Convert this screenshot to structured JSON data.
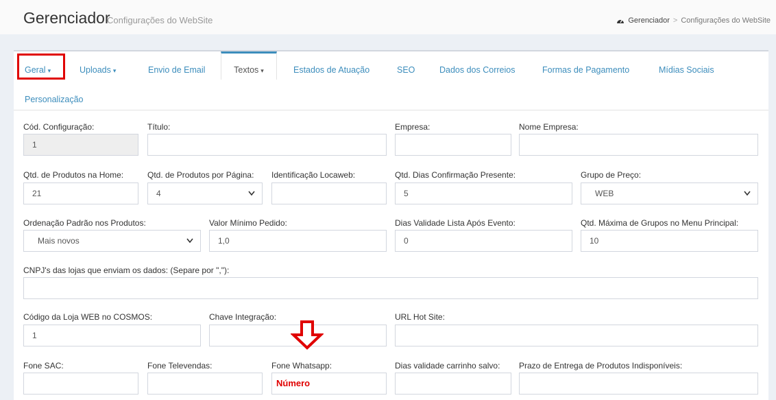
{
  "header": {
    "title": "Gerenciador",
    "subtitle": "Configurações do WebSite",
    "breadcrumb": {
      "home_icon": "dashboard-icon",
      "home": "Gerenciador",
      "separator": ">",
      "current": "Configurações do WebSite"
    }
  },
  "tabs": {
    "geral": "Geral",
    "uploads": "Uploads",
    "envio_email": "Envio de Email",
    "textos": "Textos",
    "estados": "Estados de Atuação",
    "seo": "SEO",
    "correios": "Dados dos Correios",
    "pagamento": "Formas de Pagamento",
    "midias": "Mídias Sociais",
    "personalizacao": "Personalização",
    "caret": "▾"
  },
  "form": {
    "cod_config": {
      "label": "Cód. Configuração:",
      "value": "1"
    },
    "titulo": {
      "label": "Título:",
      "value": ""
    },
    "empresa": {
      "label": "Empresa:",
      "value": ""
    },
    "nome_empresa": {
      "label": "Nome Empresa:",
      "value": ""
    },
    "qtd_home": {
      "label": "Qtd. de Produtos na Home:",
      "value": "21"
    },
    "qtd_pagina": {
      "label": "Qtd. de Produtos por Página:",
      "value": "4"
    },
    "locaweb": {
      "label": "Identificação Locaweb:",
      "value": ""
    },
    "dias_presente": {
      "label": "Qtd. Dias Confirmação Presente:",
      "value": "5"
    },
    "grupo_preco": {
      "label": "Grupo de Preço:",
      "value": "WEB"
    },
    "ordenacao": {
      "label": "Ordenação Padrão nos Produtos:",
      "value": "Mais novos"
    },
    "valor_minimo": {
      "label": "Valor Mínimo Pedido:",
      "value": "1,0"
    },
    "dias_lista": {
      "label": "Dias Validade Lista Após Evento:",
      "value": "0"
    },
    "qtd_grupos": {
      "label": "Qtd. Máxima de Grupos no Menu Principal:",
      "value": "10"
    },
    "cnpj": {
      "label": "CNPJ's das lojas que enviam os dados: (Separe por \",\"):",
      "value": ""
    },
    "cosmos": {
      "label": "Código da Loja WEB no COSMOS:",
      "value": "1"
    },
    "chave": {
      "label": "Chave Integração:",
      "value": ""
    },
    "url_hot": {
      "label": "URL Hot Site:",
      "value": ""
    },
    "fone_sac": {
      "label": "Fone SAC:",
      "value": ""
    },
    "fone_televendas": {
      "label": "Fone Televendas:",
      "value": ""
    },
    "fone_whatsapp": {
      "label": "Fone Whatsapp:",
      "value": "Número"
    },
    "dias_carrinho": {
      "label": "Dias validade carrinho salvo:",
      "value": ""
    },
    "prazo_entrega": {
      "label": "Prazo de Entrega de Produtos Indisponíveis:",
      "value": ""
    }
  },
  "select_chevron": "❯",
  "colors": {
    "accent": "#3c8dbc",
    "annotation": "#e00000"
  }
}
